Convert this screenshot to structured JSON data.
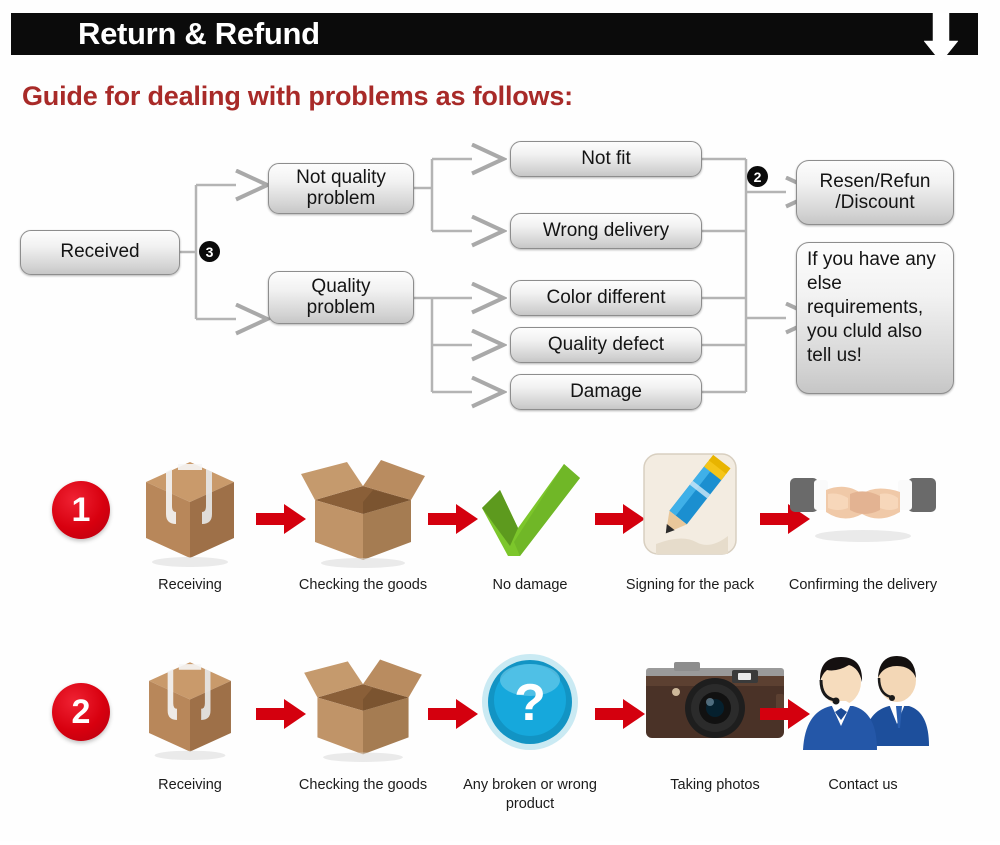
{
  "header": {
    "title": "Return & Refund",
    "arrow_icon": "down-arrow-icon",
    "bar_color": "#0b0b0b",
    "text_color": "#ffffff"
  },
  "guide": {
    "heading": "Guide for dealing with problems as follows:",
    "color": "#a82a28"
  },
  "flowchart": {
    "nodes": {
      "received": "Received",
      "not_quality_problem": "Not quality problem",
      "quality_problem": "Quality problem",
      "not_fit": "Not fit",
      "wrong_delivery": "Wrong delivery",
      "color_different": "Color different",
      "quality_defect": "Quality defect",
      "damage": "Damage",
      "resend_refund": "Resen/Refun /Discount",
      "else_requirements": "If you have any else requirements, you cluld also tell us!"
    },
    "badges": {
      "branch_three": "3",
      "branch_two": "2"
    }
  },
  "steps": {
    "rows": [
      {
        "number": "1",
        "items": [
          {
            "label": "Receiving",
            "icon": "closed-box-icon"
          },
          {
            "label": "Checking the goods",
            "icon": "open-box-icon"
          },
          {
            "label": "No damage",
            "icon": "green-check-icon"
          },
          {
            "label": "Signing for the pack",
            "icon": "pencil-signing-icon"
          },
          {
            "label": "Confirming the delivery",
            "icon": "handshake-icon"
          }
        ]
      },
      {
        "number": "2",
        "items": [
          {
            "label": "Receiving",
            "icon": "closed-box-icon"
          },
          {
            "label": "Checking the goods",
            "icon": "open-box-icon"
          },
          {
            "label": "Any broken or wrong product",
            "icon": "blue-question-icon"
          },
          {
            "label": "Taking photos",
            "icon": "camera-icon"
          },
          {
            "label": "Contact us",
            "icon": "support-agents-icon"
          }
        ]
      }
    ],
    "arrow_icon": "red-right-arrow-icon",
    "arrow_color": "#d4000e",
    "number_color": "#d8000f"
  }
}
